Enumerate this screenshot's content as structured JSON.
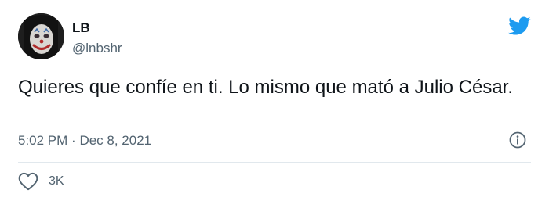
{
  "user": {
    "display_name": "LB",
    "handle": "@lnbshr",
    "avatar": "joker-face-avatar"
  },
  "tweet": {
    "text": "Quieres que confíe en ti. Lo mismo que mató a Julio César.",
    "time": "5:02 PM",
    "separator": "·",
    "date": "Dec 8, 2021"
  },
  "actions": {
    "like_icon": "heart-icon",
    "like_count": "3K"
  },
  "icons": {
    "brand": "twitter-bird-icon",
    "info": "info-icon"
  },
  "colors": {
    "twitter_blue": "#1d9bf0",
    "secondary_text": "#536471",
    "primary_text": "#0f1419",
    "divider": "#e1e8ed"
  }
}
